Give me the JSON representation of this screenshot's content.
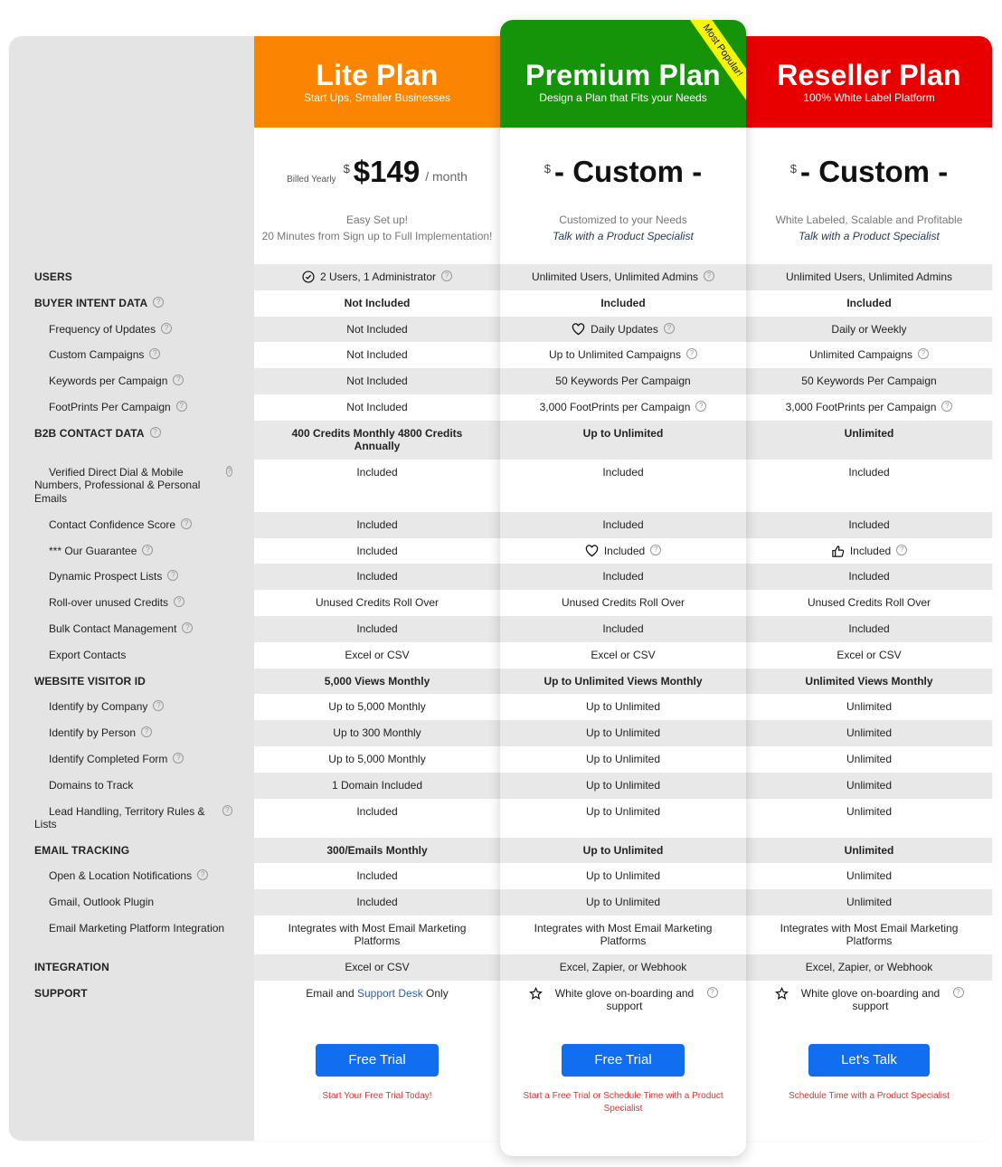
{
  "colors": {
    "lite": "#fb8500",
    "premium": "#159309",
    "reseller": "#e80000",
    "ribbon": "#f6f600",
    "cta_button": "#116ef0",
    "cta_note": "#e83030"
  },
  "features": [
    {
      "label": "USERS",
      "type": "section",
      "help": false
    },
    {
      "label": "BUYER INTENT DATA",
      "type": "section",
      "help": true
    },
    {
      "label": "Frequency of Updates",
      "type": "sub",
      "help": true
    },
    {
      "label": "Custom Campaigns",
      "type": "sub",
      "help": true
    },
    {
      "label": "Keywords per Campaign",
      "type": "sub",
      "help": true
    },
    {
      "label": "FootPrints Per Campaign",
      "type": "sub",
      "help": true
    },
    {
      "label": "B2B CONTACT DATA",
      "type": "section",
      "help": true
    },
    {
      "label": "Verified Direct Dial & Mobile Numbers, Professional & Personal Emails",
      "type": "wrap",
      "help": true
    },
    {
      "label": "Contact Confidence Score",
      "type": "sub",
      "help": true
    },
    {
      "label": "*** Our Guarantee",
      "type": "sub",
      "help": true
    },
    {
      "label": "Dynamic Prospect Lists",
      "type": "sub",
      "help": true
    },
    {
      "label": "Roll-over unused Credits",
      "type": "sub",
      "help": true
    },
    {
      "label": "Bulk Contact Management",
      "type": "sub",
      "help": true
    },
    {
      "label": "Export Contacts",
      "type": "sub",
      "help": false
    },
    {
      "label": "WEBSITE VISITOR ID",
      "type": "section",
      "help": false
    },
    {
      "label": "Identify by Company",
      "type": "sub",
      "help": true
    },
    {
      "label": "Identify by Person",
      "type": "sub",
      "help": true
    },
    {
      "label": "Identify Completed Form",
      "type": "sub",
      "help": true
    },
    {
      "label": "Domains to Track",
      "type": "sub",
      "help": false
    },
    {
      "label": "Lead Handling, Territory Rules & Lists",
      "type": "wrap",
      "help": true
    },
    {
      "label": "EMAIL TRACKING",
      "type": "section",
      "help": false
    },
    {
      "label": "Open & Location Notifications",
      "type": "sub",
      "help": true
    },
    {
      "label": "Gmail, Outlook Plugin",
      "type": "sub",
      "help": false
    },
    {
      "label": "Email Marketing Platform Integration",
      "type": "sub",
      "help": false
    },
    {
      "label": "INTEGRATION",
      "type": "section",
      "help": false
    },
    {
      "label": "SUPPORT",
      "type": "section",
      "help": false
    }
  ],
  "plans": {
    "lite": {
      "name": "Lite Plan",
      "tagline": "Start Ups, Smaller Businesses",
      "billed": "Billed Yearly",
      "currency": "$",
      "amount": "$149",
      "per": "/  month",
      "desc1": "Easy Set up!",
      "desc2": "20 Minutes from Sign up to Full Implementation!",
      "values": [
        {
          "text": "2 Users, 1 Administrator",
          "icon": "check-circle-icon",
          "help": true
        },
        {
          "text": "Not Included"
        },
        {
          "text": "Not Included"
        },
        {
          "text": "Not Included"
        },
        {
          "text": "Not Included"
        },
        {
          "text": "Not Included"
        },
        {
          "text": "400 Credits Monthly   4800 Credits Annually"
        },
        {
          "text": "Included"
        },
        {
          "text": "Included"
        },
        {
          "text": "Included"
        },
        {
          "text": "Included"
        },
        {
          "text": "Unused Credits Roll Over"
        },
        {
          "text": "Included"
        },
        {
          "text": "Excel or CSV"
        },
        {
          "text": "5,000 Views Monthly"
        },
        {
          "text": "Up to 5,000 Monthly"
        },
        {
          "text": "Up to 300 Monthly"
        },
        {
          "text": "Up to 5,000 Monthly"
        },
        {
          "text": "1 Domain Included"
        },
        {
          "text": "Included"
        },
        {
          "text": "300/Emails Monthly"
        },
        {
          "text": "Included"
        },
        {
          "text": "Included"
        },
        {
          "text": "Integrates with Most Email Marketing Platforms"
        },
        {
          "text": "Excel or CSV"
        },
        {
          "text": "Email and",
          "link": "Support Desk",
          "after": "Only"
        }
      ],
      "button": "Free Trial",
      "note": "Start Your Free Trial Today!"
    },
    "premium": {
      "name": "Premium Plan",
      "tagline": "Design a Plan that Fits your Needs",
      "ribbon": "Most Popular!",
      "currency": "$",
      "amount": "- Custom -",
      "desc1": "Customized to your Needs",
      "desc2": "Talk with a Product Specialist",
      "values": [
        {
          "text": "Unlimited Users, Unlimited Admins",
          "help": true
        },
        {
          "text": "Included"
        },
        {
          "text": "Daily Updates",
          "icon": "heart-icon",
          "help": true
        },
        {
          "text": "Up to Unlimited Campaigns",
          "help": true
        },
        {
          "text": "50 Keywords Per Campaign"
        },
        {
          "text": "3,000 FootPrints per Campaign",
          "help": true
        },
        {
          "text": "Up to Unlimited"
        },
        {
          "text": "Included"
        },
        {
          "text": "Included"
        },
        {
          "text": "Included",
          "icon": "heart-icon",
          "help": true
        },
        {
          "text": "Included"
        },
        {
          "text": "Unused Credits Roll Over"
        },
        {
          "text": "Included"
        },
        {
          "text": "Excel or CSV"
        },
        {
          "text": "Up to Unlimited Views Monthly"
        },
        {
          "text": "Up to Unlimited"
        },
        {
          "text": "Up to Unlimited"
        },
        {
          "text": "Up to Unlimited"
        },
        {
          "text": "Up to Unlimited"
        },
        {
          "text": "Up to Unlimited"
        },
        {
          "text": "Up to Unlimited"
        },
        {
          "text": "Up to Unlimited"
        },
        {
          "text": "Up to Unlimited"
        },
        {
          "text": "Integrates with Most Email Marketing Platforms"
        },
        {
          "text": "Excel, Zapier, or Webhook"
        },
        {
          "text": "White glove on-boarding and support",
          "icon": "star-icon",
          "help": true
        }
      ],
      "button": "Free Trial",
      "note": "Start a Free Trial or Schedule Time with a Product Specialist"
    },
    "reseller": {
      "name": "Reseller Plan",
      "tagline": "100% White Label Platform",
      "currency": "$",
      "amount": "- Custom -",
      "desc1": "White Labeled, Scalable and Profitable",
      "desc2": "Talk with a Product Specialist",
      "values": [
        {
          "text": "Unlimited Users, Unlimited Admins"
        },
        {
          "text": "Included"
        },
        {
          "text": "Daily or Weekly"
        },
        {
          "text": "Unlimited Campaigns",
          "help": true
        },
        {
          "text": "50 Keywords Per Campaign"
        },
        {
          "text": "3,000 FootPrints per Campaign",
          "help": true
        },
        {
          "text": "Unlimited"
        },
        {
          "text": "Included"
        },
        {
          "text": "Included"
        },
        {
          "text": "Included",
          "icon": "thumbs-up-icon",
          "help": true
        },
        {
          "text": "Included"
        },
        {
          "text": "Unused Credits Roll Over"
        },
        {
          "text": "Included"
        },
        {
          "text": "Excel or CSV"
        },
        {
          "text": "Unlimited Views Monthly"
        },
        {
          "text": "Unlimited"
        },
        {
          "text": "Unlimited"
        },
        {
          "text": "Unlimited"
        },
        {
          "text": "Unlimited"
        },
        {
          "text": "Unlimited"
        },
        {
          "text": "Unlimited"
        },
        {
          "text": "Unlimited"
        },
        {
          "text": "Unlimited"
        },
        {
          "text": "Integrates with Most Email Marketing Platforms"
        },
        {
          "text": "Excel, Zapier, or Webhook"
        },
        {
          "text": "White glove on-boarding and support",
          "icon": "star-icon",
          "help": true
        }
      ],
      "button": "Let's Talk",
      "note": "Schedule Time with a Product Specialist"
    }
  }
}
